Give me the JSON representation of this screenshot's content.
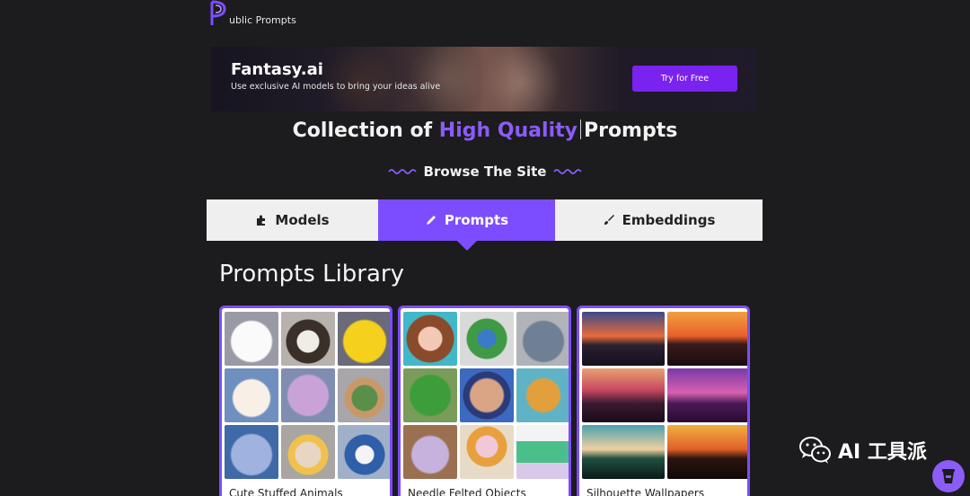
{
  "site": {
    "logo_letter": "P",
    "name": "ublic Prompts"
  },
  "banner": {
    "title": "Fantasy.ai",
    "subtitle": "Use exclusive AI models to bring your ideas alive",
    "cta": "Try for Free"
  },
  "heading": {
    "before": "Collection of",
    "highlight": "High Quality",
    "after": "Prompts"
  },
  "browse": {
    "label": "Browse The Site"
  },
  "tabs": [
    {
      "label": "Models",
      "icon": "puzzle-icon",
      "active": false
    },
    {
      "label": "Prompts",
      "icon": "pencil-icon",
      "active": true
    },
    {
      "label": "Embeddings",
      "icon": "brush-icon",
      "active": false
    }
  ],
  "library": {
    "title": "Prompts Library",
    "cards": [
      {
        "title": "Cute Stuffed Animals"
      },
      {
        "title": "Needle Felted Objects"
      },
      {
        "title": "Silhouette Wallpapers"
      }
    ]
  },
  "watermark": {
    "text": "AI 工具派"
  },
  "colors": {
    "accent": "#7c4dff",
    "background": "#1c1b1d",
    "cta": "#7a22f0"
  }
}
